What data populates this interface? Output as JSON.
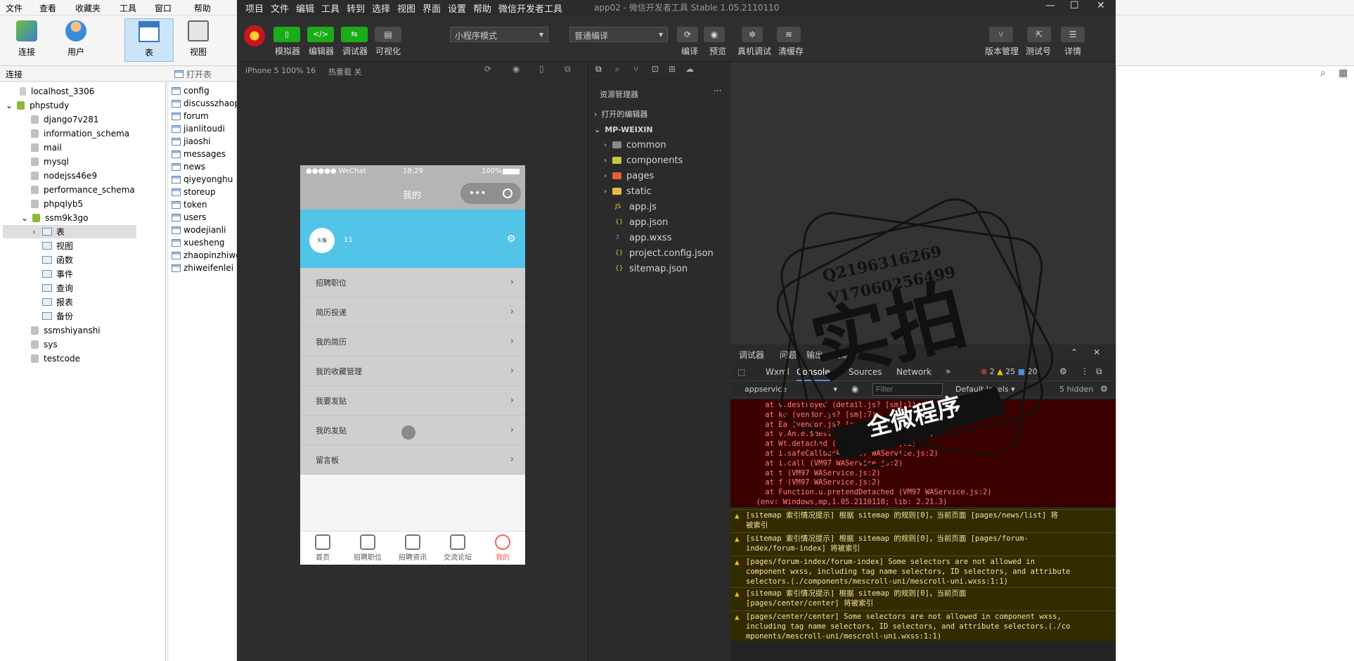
{
  "navicat": {
    "menu": [
      "文件",
      "查看",
      "收藏夹",
      "工具",
      "窗口",
      "帮助"
    ],
    "toolbar": [
      {
        "label": "连接",
        "icon": "connection-icon"
      },
      {
        "label": "用户",
        "icon": "user-icon"
      },
      {
        "label": "表",
        "icon": "table-icon"
      },
      {
        "label": "视图",
        "icon": "view-icon"
      }
    ],
    "subbar": {
      "left_label": "连接",
      "open_table": "打开表"
    },
    "tree": {
      "connection": "localhost_3306",
      "host": "phpstudy",
      "databases": [
        "django7v281",
        "information_schema",
        "mail",
        "mysql",
        "nodejss46e9",
        "performance_schema",
        "phpqlyb5"
      ],
      "open_db": "ssm9k3go",
      "objects": [
        "表",
        "视图",
        "函数",
        "事件",
        "查询",
        "报表",
        "备份"
      ],
      "more_databases": [
        "ssmshiyanshi",
        "sys",
        "testcode"
      ]
    },
    "tables": [
      "config",
      "discusszhaop",
      "forum",
      "jianlitoudi",
      "jiaoshi",
      "messages",
      "news",
      "qiyeyonghu",
      "storeup",
      "token",
      "users",
      "wodejianli",
      "xuesheng",
      "zhaopinzhiwe",
      "zhiweifenlei"
    ]
  },
  "devtools": {
    "menu": [
      "项目",
      "文件",
      "编辑",
      "工具",
      "转到",
      "选择",
      "视图",
      "界面",
      "设置",
      "帮助",
      "微信开发者工具"
    ],
    "window_title": "app02 - 微信开发者工具 Stable 1.05.2110110",
    "toolbar_buttons": [
      "模拟器",
      "编辑器",
      "调试器",
      "可视化"
    ],
    "mode_select": "小程序模式",
    "compile_select": "普通编译",
    "right_buttons": [
      "编译",
      "预览",
      "真机调试",
      "清缓存"
    ],
    "far_right_buttons": [
      "版本管理",
      "测试号",
      "详情"
    ],
    "sim_device": "iPhone 5 100% 16",
    "hot_reload": "热重载 关"
  },
  "phone": {
    "status_left": "●●●●● WeChat",
    "status_time": "18:29",
    "status_battery": "100%",
    "nav_title": "我的",
    "user_name": "11",
    "avatar_text": "头像",
    "menu": [
      "招聘职位",
      "简历投递",
      "我的简历",
      "我的收藏管理",
      "我要发贴",
      "我的发贴",
      "留言板"
    ],
    "tabs": [
      "首页",
      "招聘职位",
      "招聘资讯",
      "交流论坛",
      "我的"
    ],
    "active_color": "#ff5a5a",
    "header_color": "#52c4e8"
  },
  "explorer": {
    "title": "资源管理器",
    "open_editors": "打开的编辑器",
    "project": "MP-WEIXIN",
    "folders": [
      {
        "name": "common",
        "color": "#8a8a8a"
      },
      {
        "name": "components",
        "color": "#c9c93a"
      },
      {
        "name": "pages",
        "color": "#e06040"
      },
      {
        "name": "static",
        "color": "#e8b84a"
      }
    ],
    "files": [
      "app.js",
      "app.json",
      "app.wxss",
      "project.config.json",
      "sitemap.json"
    ]
  },
  "console": {
    "panel_tabs": [
      "调试器",
      "问题",
      "输出",
      "终端"
    ],
    "tabs": [
      "Wxml",
      "Console",
      "Sources",
      "Network"
    ],
    "active_tab": "Console",
    "errors": "2",
    "warnings": "25",
    "info": "20",
    "context": "appservice",
    "filter_placeholder": "Filter",
    "levels": "Default levels",
    "hidden": "5 hidden",
    "error_lines": [
      "    at v.destroyed (detail.js? [sm]:1)",
      "    at ke (vendor.js? [sm]:7)",
      "    at Ea (vendor.js? [sm]:7)",
      "    at v.An.e.$destroy (vendor.js? [sm]:7)",
      "    at Wt.detached (vendor.js? [sm]:1)",
      "    at i.safeCallback (VM97 WAService.js:2)",
      "    at i.call (VM97 WAService.js:2)",
      "    at t (VM97 WAService.js:2)",
      "    at f (VM97 WAService.js:2)",
      "    at Function.u.pretendDetached (VM97 WAService.js:2)",
      "  (env: Windows,mp,1.05.2110110; lib: 2.21.3)"
    ],
    "warnings_list": [
      "[sitemap 索引情况提示] 根据 sitemap 的规则[0]，当前页面 [pages/news/list] 将\n被索引",
      "[sitemap 索引情况提示] 根据 sitemap 的规则[0]，当前页面 [pages/forum-\nindex/forum-index] 将被索引",
      "[pages/forum-index/forum-index] Some selectors are not allowed in\ncomponent wxss, including tag name selectors, ID selectors, and attribute\nselectors.(./components/mescroll-uni/mescroll-uni.wxss:1:1)",
      "[sitemap 索引情况提示] 根据 sitemap 的规则[0]，当前页面\n[pages/center/center] 将被索引",
      "[pages/center/center] Some selectors are not allowed in component wxss,\nincluding tag name selectors, ID selectors, and attribute selectors.(./co\nmponents/mescroll-uni/mescroll-uni.wxss:1:1)"
    ]
  },
  "stamp": {
    "line1": "Q2196316269",
    "line2": "V17060256499",
    "big": "实拍",
    "ribbon": "全微程序"
  }
}
